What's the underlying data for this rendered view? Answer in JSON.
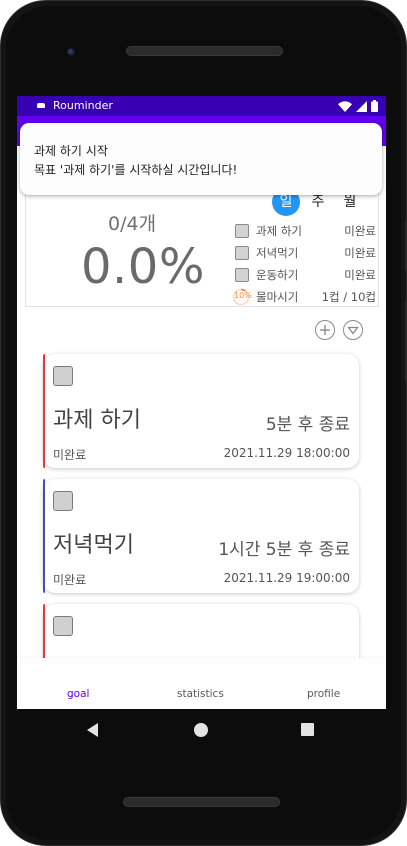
{
  "status_bar": {
    "app_name": "Rouminder"
  },
  "toast": {
    "title": "과제 하기 시작",
    "message": "목표 '과제 하기'를 시작하실 시간입니다!"
  },
  "summary": {
    "count": "0/4개",
    "percent": "0.0%",
    "period_tabs": [
      {
        "label": "일",
        "active": true
      },
      {
        "label": "주",
        "active": false
      },
      {
        "label": "월",
        "active": false
      }
    ],
    "goals": [
      {
        "name": "과제 하기",
        "status": "미완료"
      },
      {
        "name": "저녁먹기",
        "status": "미완료"
      },
      {
        "name": "운동하기",
        "status": "미완료"
      }
    ],
    "water": {
      "ring_label": "10%",
      "name": "물마시기",
      "progress": "1컵 / 10컵",
      "fraction": 0.1
    }
  },
  "actions": {
    "add_icon": "plus-circle-icon",
    "filter_icon": "triangle-down-circle-icon"
  },
  "cards": [
    {
      "title": "과제 하기",
      "remaining": "5분 후 종료",
      "status": "미완료",
      "deadline": "2021.11.29 18:00:00",
      "accent": "#e53935"
    },
    {
      "title": "저녁먹기",
      "remaining": "1시간 5분 후 종료",
      "status": "미완료",
      "deadline": "2021.11.29 19:00:00",
      "accent": "#3f51b5"
    },
    {
      "title": "",
      "remaining": "",
      "status": "",
      "deadline": "",
      "accent": "#e53935"
    }
  ],
  "bottom_nav": [
    {
      "label": "goal",
      "active": true
    },
    {
      "label": "statistics",
      "active": false
    },
    {
      "label": "profile",
      "active": false
    }
  ],
  "colors": {
    "status_bar": "#3700b3",
    "app_bar": "#6200ee",
    "active_tab": "#2196f3",
    "nav_active": "#6200ee"
  }
}
